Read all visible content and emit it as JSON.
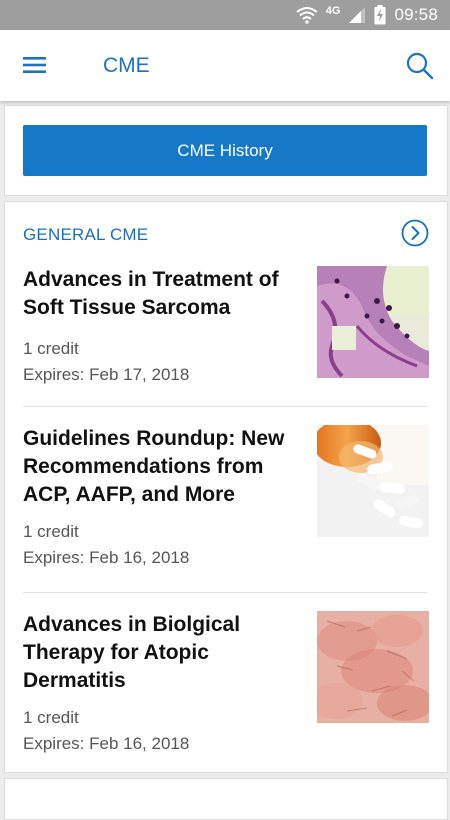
{
  "status_bar": {
    "time": "09:58",
    "network": "4G"
  },
  "app_bar": {
    "title": "CME"
  },
  "history": {
    "button_label": "CME History"
  },
  "section": {
    "title": "GENERAL CME",
    "items": [
      {
        "title": "Advances in Treatment of Soft Tissue Sarcoma",
        "credit": "1 credit",
        "expires": "Expires: Feb 17, 2018"
      },
      {
        "title": "Guidelines Roundup: New Recommendations from ACP, AAFP, and More",
        "credit": "1 credit",
        "expires": "Expires: Feb 16, 2018"
      },
      {
        "title": "Advances in Biolgical Therapy for Atopic Dermatitis",
        "credit": "1 credit",
        "expires": "Expires: Feb 16, 2018"
      }
    ]
  },
  "colors": {
    "accent": "#1578c8",
    "title_blue": "#1a73c4",
    "status_bar": "#9e9e9e"
  }
}
